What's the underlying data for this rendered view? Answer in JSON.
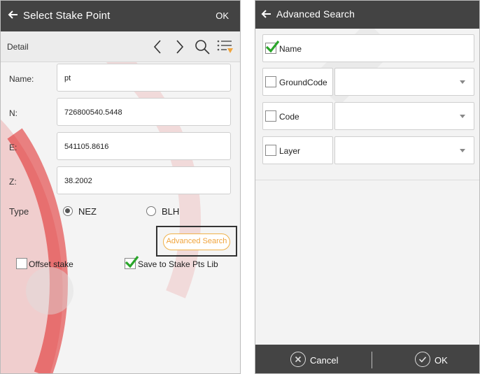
{
  "select_stake_point": {
    "title": "Select Stake Point",
    "ok_label": "OK",
    "detail_label": "Detail",
    "icons": [
      "chevron-left-icon",
      "chevron-right-icon",
      "search-icon",
      "list-filter-icon"
    ],
    "fields": [
      {
        "label": "Name:",
        "value": "pt"
      },
      {
        "label": "N:",
        "value": "726800540.5448"
      },
      {
        "label": "E:",
        "value": "541105.8616"
      },
      {
        "label": "Z:",
        "value": "38.2002"
      }
    ],
    "type_label": "Type",
    "type_options": [
      {
        "label": "NEZ",
        "selected": true
      },
      {
        "label": "BLH",
        "selected": false
      }
    ],
    "advanced_search_label": "Advanced Search",
    "offset_stake_label": "Offset stake",
    "offset_stake_checked": false,
    "save_to_lib_label": "Save to Stake Pts Lib",
    "save_to_lib_checked": true
  },
  "advanced_search": {
    "title": "Advanced Search",
    "criteria": [
      {
        "label": "Name",
        "checked": true,
        "value": ""
      },
      {
        "label": "GroundCode",
        "checked": false,
        "value": ""
      },
      {
        "label": "Code",
        "checked": false,
        "value": ""
      },
      {
        "label": "Layer",
        "checked": false,
        "value": ""
      }
    ],
    "cancel_label": "Cancel",
    "ok_label": "OK"
  },
  "colors": {
    "titlebar": "#434343",
    "accent_orange": "#f0a43c",
    "check_green": "#2aa52a",
    "watermark_red": "#e02020"
  }
}
